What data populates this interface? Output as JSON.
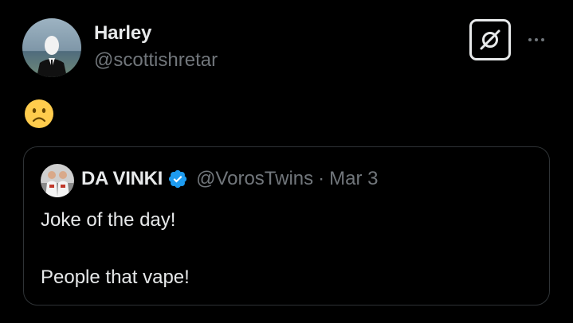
{
  "post": {
    "author": {
      "display_name": "Harley",
      "handle": "@scottishretar",
      "avatar_icon": "profile-photo-person-in-suit"
    },
    "body_emoji": "🙁",
    "actions": {
      "grok_icon": "grok-icon",
      "more_icon": "more-dots-icon"
    }
  },
  "quote": {
    "display_name": "DA VINKI",
    "verified": true,
    "handle": "@VorosTwins",
    "separator": "·",
    "date": "Mar 3",
    "text_lines": [
      "Joke of the day!",
      "",
      "People that vape!"
    ]
  },
  "colors": {
    "background": "#000000",
    "text_primary": "#e7e9ea",
    "text_secondary": "#71767b",
    "border": "#2f3336",
    "verified_blue": "#1d9bf0"
  }
}
